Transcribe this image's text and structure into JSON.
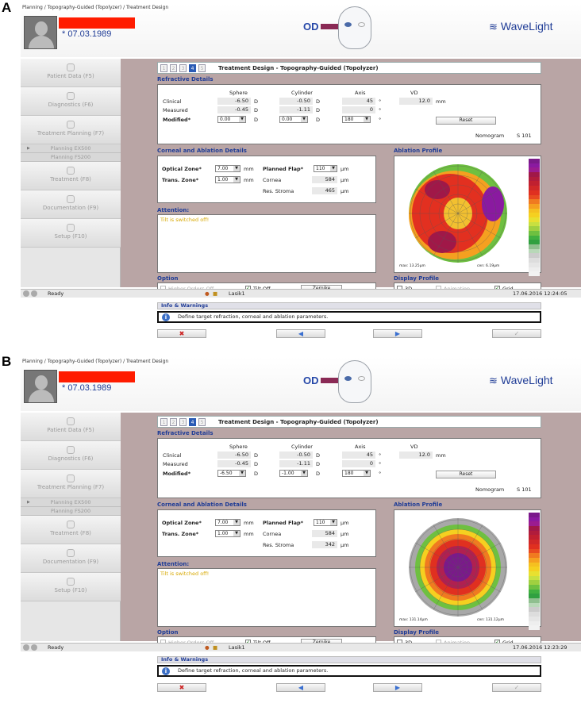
{
  "panels": [
    {
      "letter": "A",
      "breadcrumb": "Planning / Topography-Guided (Topolyzer) / Treatment Design",
      "dob": "* 07.03.1989",
      "eye": "OD",
      "brand": "WaveLight",
      "sidebar": {
        "items": [
          "Patient Data (F5)",
          "Diagnostics (F6)",
          "Treatment Planning (F7)"
        ],
        "subs": [
          "Planning EX500",
          "Planning FS200"
        ],
        "items2": [
          "Treatment (F8)",
          "Documentation (F9)",
          "Setup (F10)"
        ]
      },
      "title": "Treatment Design - Topography-Guided (Topolyzer)",
      "steps": [
        "1",
        "2",
        "3",
        "4",
        "5"
      ],
      "refractive": {
        "heading": "Refractive Details",
        "col_sphere": "Sphere",
        "col_cyl": "Cylinder",
        "col_axis": "Axis",
        "col_vd": "VD",
        "row_clinical": "Clinical",
        "row_measured": "Measured",
        "row_modified": "Modified*",
        "clin_sphere": "-6.50",
        "clin_cyl": "-0.50",
        "clin_axis": "45",
        "vd": "12.0",
        "meas_sphere": "-0.45",
        "meas_cyl": "-1.11",
        "meas_axis": "0",
        "mod_sphere": "0.00",
        "mod_cyl": "0.00",
        "mod_axis": "180",
        "unit_d": "D",
        "unit_deg": "°",
        "unit_mm": "mm",
        "reset": "Reset",
        "nomogram_label": "Nomogram",
        "nomogram_value": "S 101"
      },
      "corneal": {
        "heading": "Corneal and Ablation Details",
        "oz_label": "Optical Zone*",
        "oz": "7.00",
        "tz_label": "Trans. Zone*",
        "tz": "1.00",
        "flap_label": "Planned Flap*",
        "flap": "110",
        "cornea_label": "Cornea",
        "cornea": "584",
        "stroma_label": "Res. Stroma",
        "stroma": "465",
        "um": "µm",
        "mm": "mm"
      },
      "ablation": {
        "heading": "Ablation Profile",
        "max": "max: 13.25µm",
        "cen": "cen: 6.19µm"
      },
      "attention": {
        "heading": "Attention:",
        "text": "Tilt is switched off!"
      },
      "option": {
        "heading": "Option",
        "hoo": "Higher Orders Off",
        "tilt": "Tilt Off",
        "zernike": "Zernike"
      },
      "display": {
        "heading": "Display Profile",
        "d3": "3D",
        "anim": "Animation",
        "grid": "Grid"
      },
      "info": {
        "heading": "Info & Warnings",
        "text": "Define target refraction, corneal and ablation parameters."
      },
      "status": {
        "ready": "Ready",
        "user": "Lasik1",
        "datetime": "17.06.2016 12:24:05"
      }
    },
    {
      "letter": "B",
      "breadcrumb": "Planning / Topography-Guided (Topolyzer) / Treatment Design",
      "dob": "* 07.03.1989",
      "eye": "OD",
      "brand": "WaveLight",
      "sidebar": {
        "items": [
          "Patient Data (F5)",
          "Diagnostics (F6)",
          "Treatment Planning (F7)"
        ],
        "subs": [
          "Planning EX500",
          "Planning FS200"
        ],
        "items2": [
          "Treatment (F8)",
          "Documentation (F9)",
          "Setup (F10)"
        ]
      },
      "title": "Treatment Design - Topography-Guided (Topolyzer)",
      "steps": [
        "1",
        "2",
        "3",
        "4",
        "5"
      ],
      "refractive": {
        "heading": "Refractive Details",
        "col_sphere": "Sphere",
        "col_cyl": "Cylinder",
        "col_axis": "Axis",
        "col_vd": "VD",
        "row_clinical": "Clinical",
        "row_measured": "Measured",
        "row_modified": "Modified*",
        "clin_sphere": "-6.50",
        "clin_cyl": "-0.50",
        "clin_axis": "45",
        "vd": "12.0",
        "meas_sphere": "-0.45",
        "meas_cyl": "-1.11",
        "meas_axis": "0",
        "mod_sphere": "-6.50",
        "mod_cyl": "-1.00",
        "mod_axis": "180",
        "unit_d": "D",
        "unit_deg": "°",
        "unit_mm": "mm",
        "reset": "Reset",
        "nomogram_label": "Nomogram",
        "nomogram_value": "S 101"
      },
      "corneal": {
        "heading": "Corneal and Ablation Details",
        "oz_label": "Optical Zone*",
        "oz": "7.00",
        "tz_label": "Trans. Zone*",
        "tz": "1.00",
        "flap_label": "Planned Flap*",
        "flap": "110",
        "cornea_label": "Cornea",
        "cornea": "584",
        "stroma_label": "Res. Stroma",
        "stroma": "342",
        "um": "µm",
        "mm": "mm"
      },
      "ablation": {
        "heading": "Ablation Profile",
        "max": "max: 131.14µm",
        "cen": "cen: 131.12µm"
      },
      "attention": {
        "heading": "Attention:",
        "text": "Tilt is switched off!"
      },
      "option": {
        "heading": "Option",
        "hoo": "Higher Orders Off",
        "tilt": "Tilt Off",
        "zernike": "Zernike"
      },
      "display": {
        "heading": "Display Profile",
        "d3": "3D",
        "anim": "Animation",
        "grid": "Grid"
      },
      "info": {
        "heading": "Info & Warnings",
        "text": "Define target refraction, corneal and ablation parameters."
      },
      "status": {
        "ready": "Ready",
        "user": "Lasik1",
        "datetime": "17.06.2016 12:23:29"
      }
    }
  ],
  "colors": {
    "accent": "#1f3c96",
    "redaction": "#ff1c00",
    "background": "#b9a5a5"
  },
  "icons": [
    "user-icon",
    "diagnostics-icon",
    "planning-icon",
    "treatment-icon",
    "documentation-icon",
    "setup-icon",
    "info-icon",
    "cancel-icon",
    "back-icon",
    "next-icon",
    "confirm-icon"
  ]
}
